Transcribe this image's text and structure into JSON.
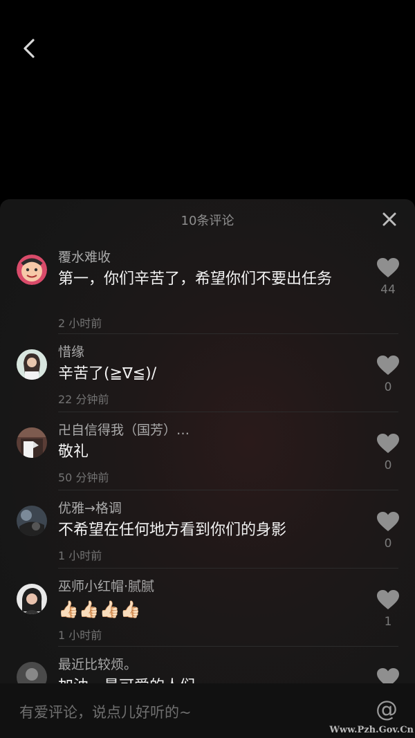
{
  "sheet": {
    "title": "10条评论"
  },
  "comments": [
    {
      "user": "覆水难收",
      "text": "第一，你们辛苦了，希望你们不要出任务",
      "time": "2 小时前",
      "likes": "44"
    },
    {
      "user": "惜缘",
      "text": "辛苦了(≧∇≦)/",
      "time": "22 分钟前",
      "likes": "0"
    },
    {
      "user": "卍自信得我（国芳）…",
      "text": "敬礼",
      "time": "50 分钟前",
      "likes": "0"
    },
    {
      "user": "优雅→格调",
      "text": "不希望在任何地方看到你们的身影",
      "time": "1 小时前",
      "likes": "0"
    },
    {
      "user": "巫师小红帽·腻腻",
      "text": "👍🏻👍🏻👍🏻👍🏻",
      "time": "1 小时前",
      "likes": "1"
    },
    {
      "user": "最近比较烦。",
      "text": "加油，最可爱的人们",
      "time": "",
      "likes": ""
    }
  ],
  "input": {
    "placeholder": "有爱评论，说点儿好听的~",
    "at_symbol": "@"
  },
  "watermark": "Www.Pzh.Gov.Cn",
  "colors": {
    "background": "#000000",
    "sheet": "#171717",
    "text_primary": "#f2f2f2",
    "text_secondary": "#a9a9a9"
  }
}
